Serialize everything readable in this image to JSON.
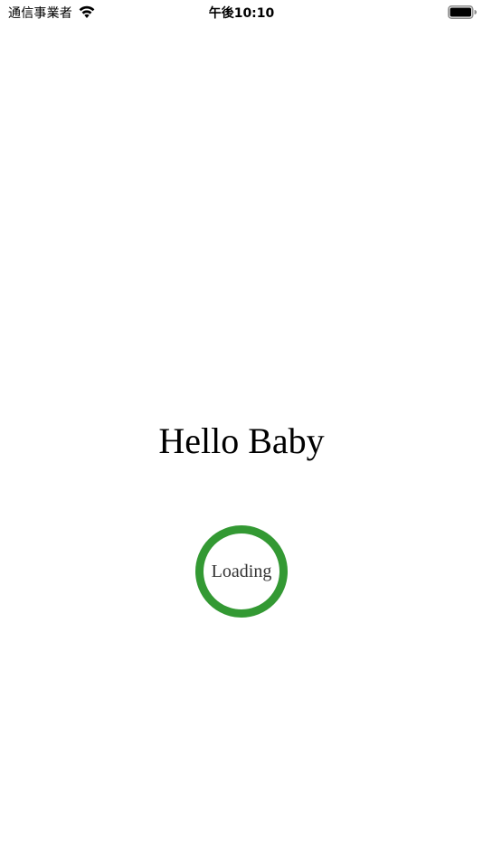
{
  "status_bar": {
    "carrier": "通信事業者",
    "time": "午後10:10",
    "wifi_icon": "wifi-icon",
    "battery_icon": "battery-icon"
  },
  "main": {
    "greeting": "Hello Baby",
    "loader": {
      "label": "Loading",
      "ring_color": "#339933",
      "progress": 1.0
    }
  }
}
